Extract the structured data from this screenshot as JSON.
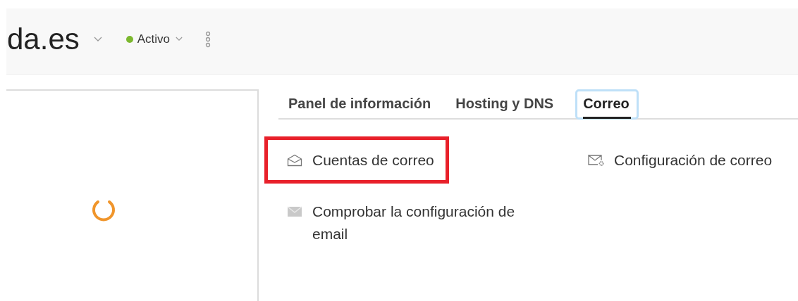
{
  "header": {
    "title": "da.es",
    "status": {
      "label": "Activo",
      "color": "#7cb82f"
    }
  },
  "tabs": [
    {
      "label": "Panel de información",
      "selected": false,
      "focused": false
    },
    {
      "label": "Hosting y DNS",
      "selected": false,
      "focused": false
    },
    {
      "label": "Correo",
      "selected": true,
      "focused": true
    }
  ],
  "links": [
    {
      "kind": "envelope-outline",
      "label": "Cuentas de correo",
      "highlighted": true
    },
    {
      "kind": "envelope-gear",
      "label": "Configuración de correo",
      "highlighted": false
    },
    {
      "kind": "envelope-filled",
      "label": "Comprobar la configuración de email",
      "highlighted": false
    }
  ]
}
